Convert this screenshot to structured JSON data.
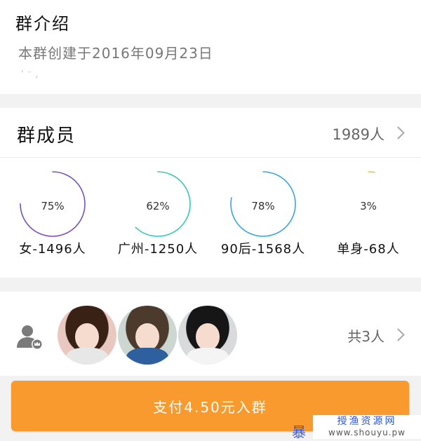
{
  "intro": {
    "title": "群介绍",
    "description": "本群创建于2016年09月23日",
    "faint_text": "' ⁻ ,"
  },
  "members": {
    "title": "群成员",
    "count": "1989人"
  },
  "stats": [
    {
      "percent_label": "75%",
      "label": "女-1496人",
      "value": 0.75,
      "color": "#7b4fbf"
    },
    {
      "percent_label": "62%",
      "label": "广州-1250人",
      "value": 0.62,
      "color": "#3cc6b3"
    },
    {
      "percent_label": "78%",
      "label": "90后-1568人",
      "value": 0.78,
      "color": "#3aa6e0"
    },
    {
      "percent_label": "3%",
      "label": "单身-68人",
      "value": 0.03,
      "color": "#e6c43a"
    }
  ],
  "avatars": {
    "total": "共3人",
    "items": [
      {
        "name": "member-1",
        "hair": "#3a2116",
        "bg": "#e8c8c0",
        "shirt": "#e7e7e7"
      },
      {
        "name": "member-2",
        "hair": "#4c3a2c",
        "bg": "#cdd7d1",
        "shirt": "#2e5f9e"
      },
      {
        "name": "member-3",
        "hair": "#161616",
        "bg": "#d8dadb",
        "shirt": "#f4f4f4"
      }
    ]
  },
  "pay_button": {
    "label": "支付4.50元入群"
  },
  "watermark": {
    "left": "暴",
    "cn": "授渔资源网",
    "url": "www.shouyu.pw"
  },
  "icons": {
    "member_chevron": "chevron-right-icon",
    "avatar_chevron": "chevron-right-icon",
    "owner": "user-crown-icon"
  }
}
